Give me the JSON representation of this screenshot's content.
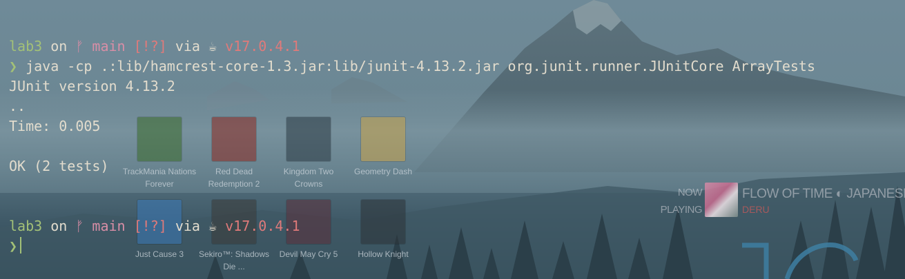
{
  "terminal": {
    "prompt1": {
      "dir": "lab3",
      "on": "on",
      "branch_icon": "ᚠ",
      "branch": "main",
      "status": "[!?]",
      "via": "via",
      "java_icon": "☕",
      "java_version": "v17.0.4.1"
    },
    "command_symbol": "❯",
    "command": "java -cp .:lib/hamcrest-core-1.3.jar:lib/junit-4.13.2.jar org.junit.runner.JUnitCore ArrayTests",
    "output": {
      "version": "JUnit version 4.13.2",
      "dots": "..",
      "time": "Time: 0.005",
      "result": "OK (2 tests)"
    },
    "prompt2": {
      "dir": "lab3",
      "on": "on",
      "branch_icon": "ᚠ",
      "branch": "main",
      "status": "[!?]",
      "via": "via",
      "java_icon": "☕",
      "java_version": "v17.0.4.1"
    },
    "prompt_symbol": "❯"
  },
  "desktop_icons": [
    {
      "label": "TrackMania Nations Forever",
      "icon": "trackmania-icon",
      "color": "#3b6b2b"
    },
    {
      "label": "Red Dead Redemption 2",
      "icon": "red-dead-icon",
      "color": "#8c2a22"
    },
    {
      "label": "Kingdom Two Crowns",
      "icon": "kingdom-icon",
      "color": "#2b3a44"
    },
    {
      "label": "Geometry Dash",
      "icon": "geometry-dash-icon",
      "color": "#c9a44b"
    },
    {
      "label": "Just Cause 3",
      "icon": "just-cause-icon",
      "color": "#3a79b8"
    },
    {
      "label": "Sekiro™: Shadows Die ...",
      "icon": "sekiro-icon",
      "color": "#3a3a38"
    },
    {
      "label": "Devil May Cry 5",
      "icon": "devil-may-cry-icon",
      "color": "#5b2f3b"
    },
    {
      "label": "Hollow Knight",
      "icon": "hollow-knight-icon",
      "color": "#2c3338"
    }
  ],
  "now_playing": {
    "label": "NOW PLAYING",
    "title": "FLOW OF TIME ◐ JAPANESE",
    "artist": "DERU"
  },
  "colors": {
    "prompt_green": "#a3c177",
    "branch_pink": "#d98ea6",
    "version_red": "#e07a7a",
    "text": "#e2dccd"
  }
}
